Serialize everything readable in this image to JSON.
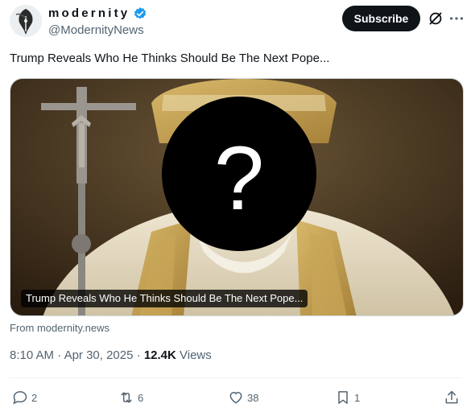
{
  "author": {
    "display_name": "modernity",
    "handle": "@ModernityNews",
    "verified_icon": "verified-badge-icon",
    "avatar_icon": "pen-nib-logo"
  },
  "header": {
    "subscribe_label": "Subscribe",
    "grok_icon": "grok-icon",
    "more_icon": "more-dots-icon"
  },
  "post": {
    "text": "Trump Reveals Who He Thinks Should Be The Next Pope..."
  },
  "card": {
    "title": "Trump Reveals Who He Thinks Should Be The Next Pope...",
    "source": "From modernity.news"
  },
  "meta": {
    "time": "8:10 AM",
    "separator": " · ",
    "date": "Apr 30, 2025",
    "dot": " · ",
    "views_count": "12.4K",
    "views_label": " Views"
  },
  "actions": {
    "replies": "2",
    "reposts": "6",
    "likes": "38",
    "bookmarks": "1"
  },
  "colors": {
    "verified": "#1d9bf0",
    "text": "#0f1419",
    "muted": "#536471",
    "button": "#0f1419"
  }
}
